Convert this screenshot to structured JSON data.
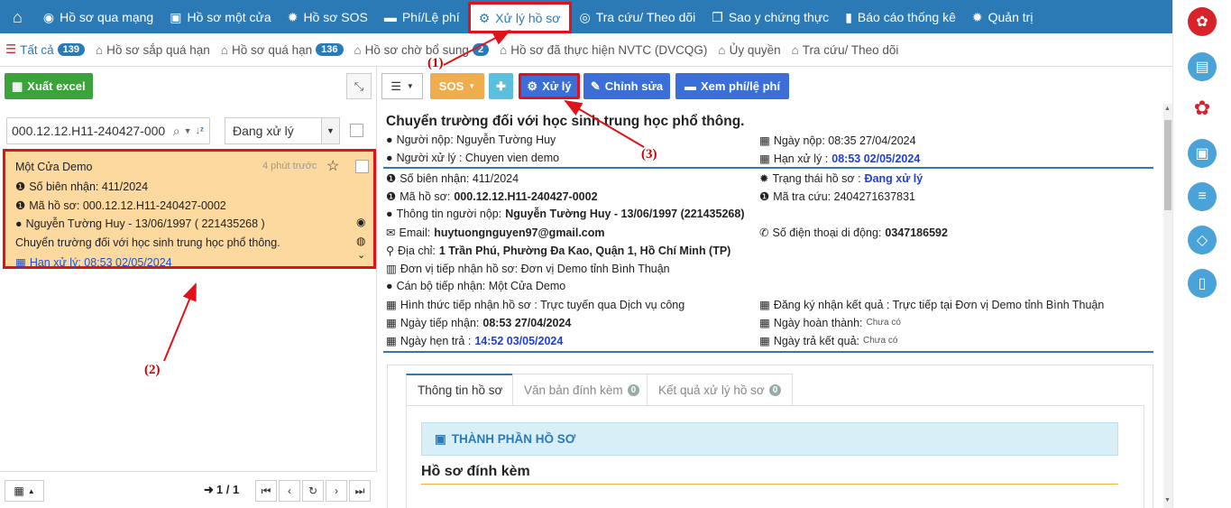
{
  "topnav": {
    "items": [
      {
        "label": "Hồ sơ qua mạng",
        "icon": "globe-icon"
      },
      {
        "label": "Hồ sơ một cửa",
        "icon": "briefcase-icon"
      },
      {
        "label": "Hồ sơ SOS",
        "icon": "gear-icon"
      },
      {
        "label": "Phí/Lệ phí",
        "icon": "card-icon"
      },
      {
        "label": "Xử lý hồ sơ",
        "icon": "gears-icon"
      },
      {
        "label": "Tra cứu/ Theo dõi",
        "icon": "eye-icon"
      },
      {
        "label": "Sao y chứng thực",
        "icon": "copy-icon"
      },
      {
        "label": "Báo cáo thống kê",
        "icon": "bar-chart-icon"
      },
      {
        "label": "Quản trị",
        "icon": "gear-icon"
      }
    ]
  },
  "subtabs": [
    {
      "label": "Tất cả",
      "badge": "139"
    },
    {
      "label": "Hồ sơ sắp quá hạn",
      "badge": ""
    },
    {
      "label": "Hồ sơ quá hạn",
      "badge": "136"
    },
    {
      "label": "Hồ sơ chờ bổ sung",
      "badge": "2"
    },
    {
      "label": "Hồ sơ đã thực hiện NVTC (DVCQG)",
      "badge": ""
    },
    {
      "label": "Ủy quyền",
      "badge": ""
    },
    {
      "label": "Tra cứu/ Theo dõi",
      "badge": ""
    }
  ],
  "left": {
    "export_label": "Xuất excel",
    "search_value": "000.12.12.H11-240427-000",
    "status_select": "Đang xử lý",
    "card": {
      "title": "Một Cửa Demo",
      "time": "4 phút trước",
      "receipt": "Số biên nhận: 411/2024",
      "code": "Mã hồ sơ: 000.12.12.H11-240427-0002",
      "person": "Nguyễn Tường Huy - 13/06/1997 ( 221435268 )",
      "desc": "Chuyển trường đối với học sinh trung học phổ thông.",
      "deadline": "Hạn xử lý: 08:53 02/05/2024"
    },
    "pager": "1 / 1"
  },
  "toolbar": {
    "sos": "SOS",
    "xuly": "Xử lý",
    "chinhsua": "Chỉnh sửa",
    "xemphi": "Xem phí/lệ phí"
  },
  "detail": {
    "title": "Chuyển trường đối với học sinh trung học phổ thông.",
    "nguoi_nop": "Người nộp: Nguyễn Tường Huy",
    "ngay_nop": "Ngày nộp: 08:35 27/04/2024",
    "nguoi_xu_ly": "Người xử lý : Chuyen vien demo",
    "han_xu_ly_label": "Hạn xử lý :",
    "han_xu_ly": "08:53 02/05/2024",
    "so_bien_nhan": "Số biên nhận: 411/2024",
    "trang_thai_label": "Trạng thái hồ sơ :",
    "trang_thai": "Đang xử lý",
    "ma_ho_so_label": "Mã hồ sơ:",
    "ma_ho_so": "000.12.12.H11-240427-0002",
    "ma_tra_cuu": "Mã tra cứu: 2404271637831",
    "ttnn_label": "Thông tin người nộp:",
    "ttnn": "Nguyễn Tường Huy - 13/06/1997 (221435268)",
    "email_label": "Email:",
    "email": "huytuongnguyen97@gmail.com",
    "sdt_label": "Số điện thoại di động:",
    "sdt": "0347186592",
    "diachi_label": "Địa chỉ:",
    "diachi": "1 Trần Phú, Phường Đa Kao, Quận 1, Hồ Chí Minh (TP)",
    "donvi": "Đơn vị tiếp nhận hồ sơ: Đơn vị Demo tỉnh Bình Thuận",
    "canbo": "Cán bộ tiếp nhận: Một Cửa Demo",
    "hinhthuc": "Hình thức tiếp nhận hồ sơ : Trực tuyến qua Dịch vụ công",
    "dangky": "Đăng ký nhận kết quả : Trực tiếp tại Đơn vị Demo tỉnh Bình Thuận",
    "ngay_tiep_nhan_label": "Ngày tiếp nhận:",
    "ngay_tiep_nhan": "08:53 27/04/2024",
    "ngay_hoan_thanh_label": "Ngày hoàn thành:",
    "ngay_hoan_thanh": "Chưa có",
    "ngay_hen_tra_label": "Ngày hẹn trả :",
    "ngay_hen_tra": "14:52 03/05/2024",
    "ngay_tra_label": "Ngày trả kết quả:",
    "ngay_tra": "Chưa có"
  },
  "panel": {
    "tab1": "Thông tin hồ sơ",
    "tab2": "Văn bản đính kèm",
    "tab2_badge": "0",
    "tab3": "Kết quả xử lý hồ sơ",
    "tab3_badge": "0",
    "section": "THÀNH PHẦN HỒ SƠ",
    "attach_title": "Hồ sơ đính kèm"
  },
  "annotations": {
    "a1": "(1)",
    "a2": "(2)",
    "a3": "(3)"
  },
  "colors": {
    "primary": "#2c7ab5",
    "highlight": "#e0131a",
    "card": "#fcd99e",
    "excel": "#3aa43a",
    "sos": "#f0ad4e",
    "pin": "#5bc0de",
    "button": "#3b6ed6"
  }
}
